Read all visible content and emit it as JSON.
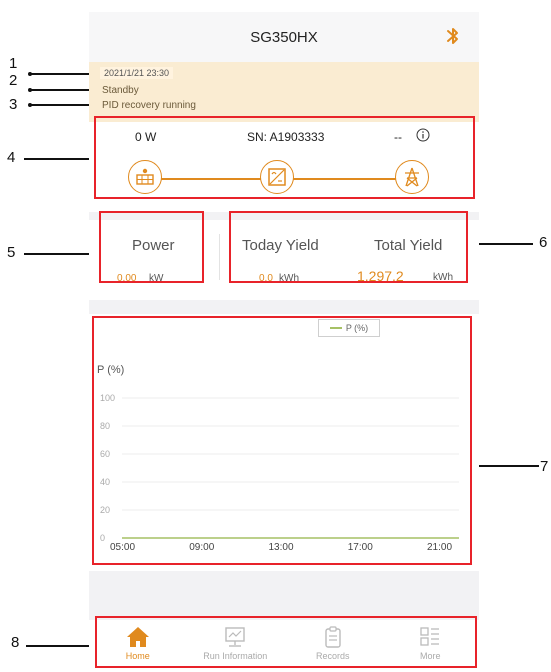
{
  "header": {
    "title": "SG350HX"
  },
  "status": {
    "timestamp": "2021/1/21 23:30",
    "state": "Standby",
    "message": "PID recovery running"
  },
  "flow": {
    "pv_power": "0 W",
    "serial": "SN: A1903333",
    "grid_value": "-- "
  },
  "stats": {
    "power_label": "Power",
    "power_value": "0.00",
    "power_unit": "kW",
    "today_label": "Today Yield",
    "today_value": "0.0",
    "today_unit": "kWh",
    "total_label": "Total Yield",
    "total_value": "1,297.2",
    "total_unit": "kWh"
  },
  "chart_data": {
    "type": "line",
    "ylabel": "P (%)",
    "x": [
      "05:00",
      "09:00",
      "13:00",
      "17:00",
      "21:00"
    ],
    "ylim": [
      0,
      100
    ],
    "yticks": [
      0,
      20,
      40,
      60,
      80,
      100
    ],
    "grid": true,
    "legend": "top-right",
    "series": [
      {
        "name": "P (%)",
        "color": "#a6c165",
        "values": [
          0,
          0,
          0,
          0,
          0
        ]
      }
    ]
  },
  "tabs": [
    {
      "label": "Home",
      "icon": "home-icon",
      "active": true
    },
    {
      "label": "Run Information",
      "icon": "monitor-icon",
      "active": false
    },
    {
      "label": "Records",
      "icon": "clipboard-icon",
      "active": false
    },
    {
      "label": "More",
      "icon": "grid-list-icon",
      "active": false
    }
  ],
  "callouts": [
    "1",
    "2",
    "3",
    "4",
    "5",
    "6",
    "7",
    "8"
  ],
  "colors": {
    "accent": "#e08a1e",
    "highlight": "#e8232a",
    "status_bg": "#faecd2"
  }
}
